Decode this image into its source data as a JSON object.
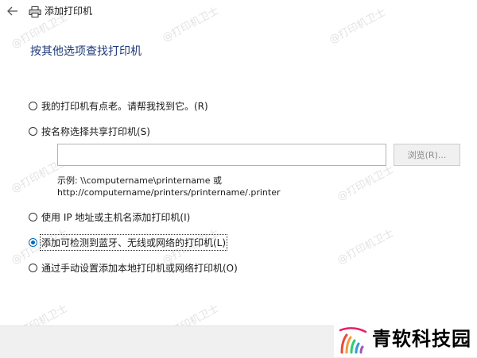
{
  "window": {
    "title": "添加打印机"
  },
  "heading": "按其他选项查找打印机",
  "options": [
    {
      "label": "我的打印机有点老。请帮我找到它。(R)",
      "selected": false
    },
    {
      "label": "按名称选择共享打印机(S)",
      "selected": false
    },
    {
      "label": "使用 IP 地址或主机名添加打印机(I)",
      "selected": false
    },
    {
      "label": "添加可检测到蓝牙、无线或网络的打印机(L)",
      "selected": true
    },
    {
      "label": "通过手动设置添加本地打印机或网络打印机(O)",
      "selected": false
    }
  ],
  "share": {
    "input_value": "",
    "browse_label": "浏览(R)...",
    "example_line1": "示例: \\\\computername\\printername 或",
    "example_line2": "http://computername/printers/printername/.printer"
  },
  "watermark": "@打印机卫士",
  "brand": {
    "name": "青软科技园"
  },
  "colors": {
    "accent": "#0067c0",
    "heading": "#1f3a78",
    "footer": "#f0f0f0"
  },
  "icons": {
    "back": "arrow-left-icon",
    "printer": "printer-icon",
    "brand": "brand-logo-icon"
  }
}
